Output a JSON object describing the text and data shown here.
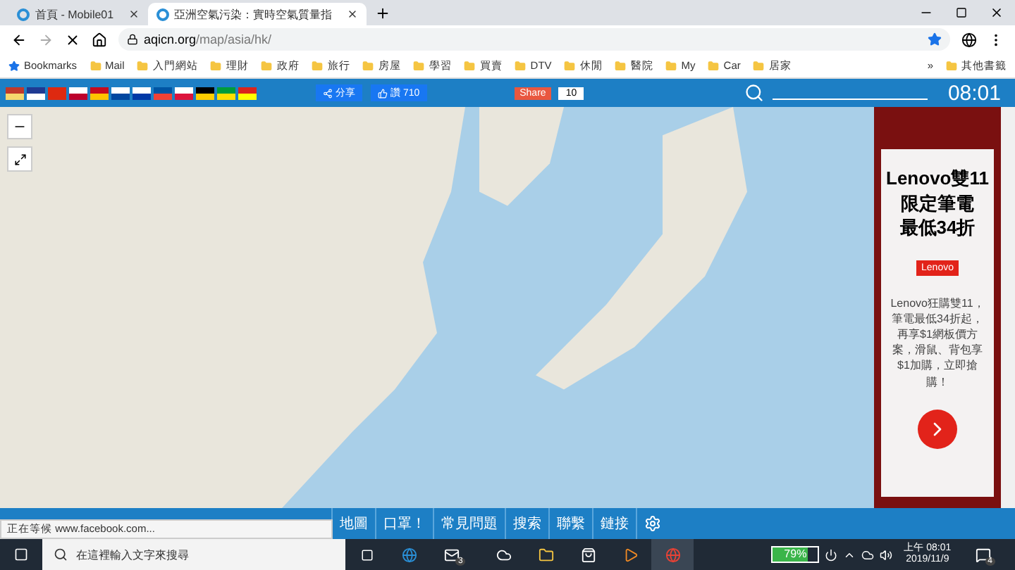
{
  "tabs": [
    {
      "title": "首頁 - Mobile01",
      "selected": false
    },
    {
      "title": "亞洲空氣污染：實時空氣質量指",
      "selected": true
    }
  ],
  "address": {
    "domain": "aqicn.org",
    "path": "/map/asia/hk/"
  },
  "bookmarks": [
    "Bookmarks",
    "Mail",
    "入門網站",
    "理財",
    "政府",
    "旅行",
    "房屋",
    "學習",
    "買賣",
    "DTV",
    "休閒",
    "醫院",
    "My",
    "Car",
    "居家"
  ],
  "bookmarks_more": "»",
  "other_bookmarks": "其他書籤",
  "site_bar": {
    "fb_share": "分享",
    "like": "讚 710",
    "share": "Share",
    "share_count": "10",
    "clock": "08:01"
  },
  "ad": {
    "headline": [
      "Lenovo雙11",
      "限定筆電",
      "最低34折"
    ],
    "brand": "Lenovo",
    "body": "Lenovo狂購雙11，筆電最低34折起，再享$1網板價方案，滑鼠、背包享$1加購，立即搶購！"
  },
  "status": "正在等候 www.facebook.com...",
  "nav": [
    {
      "label": "地圖"
    },
    {
      "label": "口罩！"
    },
    {
      "label": "常見問題"
    },
    {
      "label": "搜索"
    },
    {
      "label": "聯繫"
    },
    {
      "label": "鏈接"
    }
  ],
  "taskbar": {
    "search_placeholder": "在這裡輸入文字來搜尋",
    "mail_badge": "3",
    "battery": {
      "reading": "79%",
      "level": 0.79
    },
    "time": "上午 08:01",
    "date": "2019/11/9",
    "notifications": "4"
  }
}
